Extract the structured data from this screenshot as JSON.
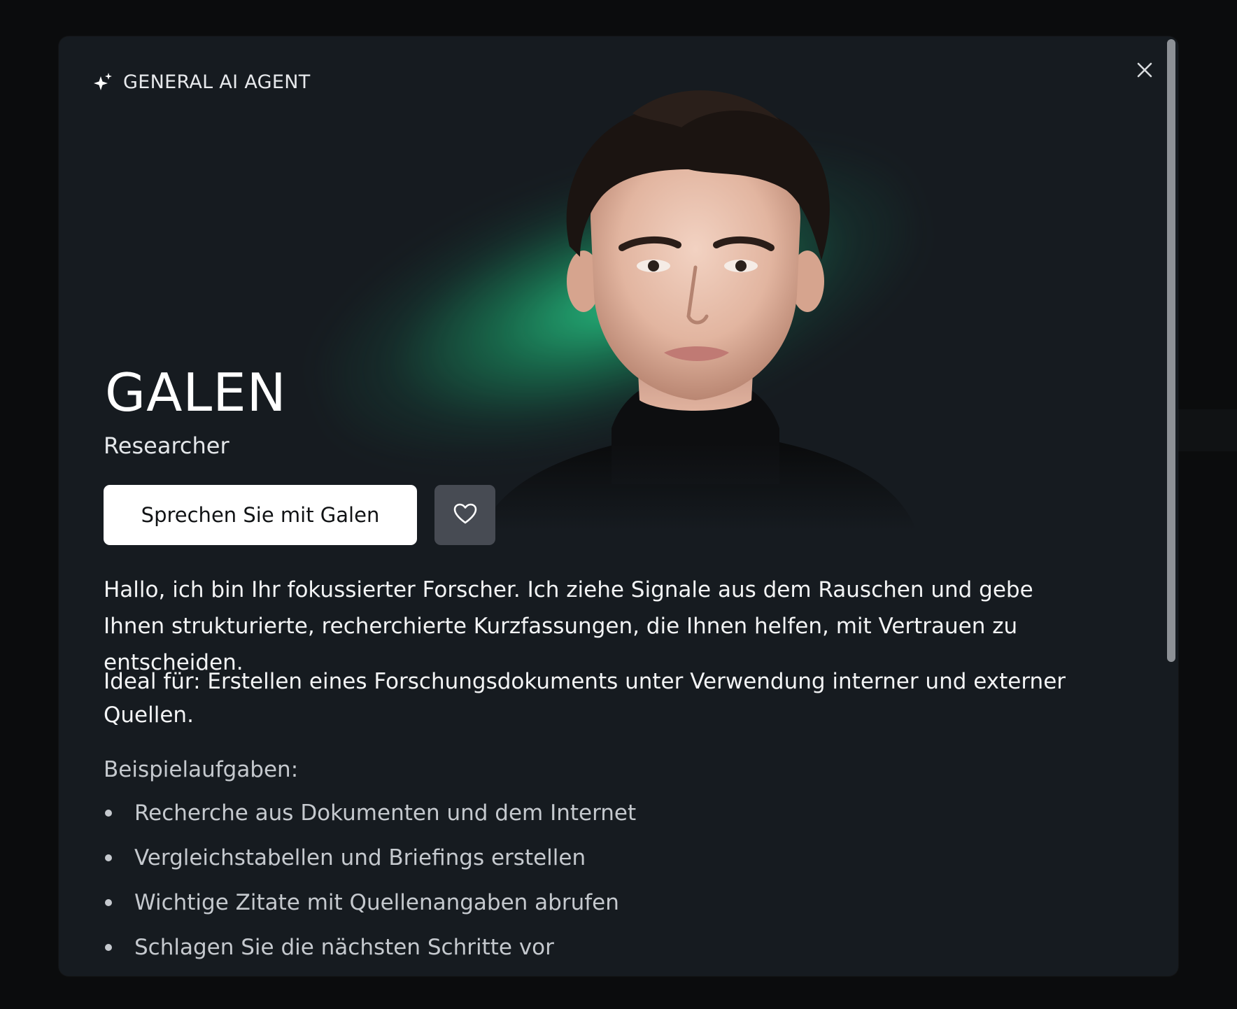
{
  "agent": {
    "category": "GENERAL AI AGENT",
    "name": "GALEN",
    "role": "Researcher"
  },
  "actions": {
    "talk_label": "Sprechen Sie mit Galen",
    "favorite_icon": "heart-icon",
    "close_icon": "close-icon"
  },
  "content": {
    "description": "Hallo, ich bin Ihr fokussierter Forscher. Ich ziehe Signale aus dem Rauschen und gebe Ihnen strukturierte, recherchierte Kurzfassungen, die Ihnen helfen, mit Vertrauen zu entscheiden.",
    "ideal_for": "Ideal für: Erstellen eines Forschungsdokuments unter Verwendung interner und externer Quellen.",
    "tasks_title": "Beispielaufgaben:",
    "tasks": [
      "Recherche aus Dokumenten und dem Internet",
      "Vergleichstabellen und Briefings erstellen",
      "Wichtige Zitate mit Quellenangaben abrufen",
      "Schlagen Sie die nächsten Schritte vor"
    ]
  },
  "colors": {
    "modal_bg": "#161b20",
    "glow": "#28d28c",
    "primary_button_bg": "#ffffff",
    "secondary_button_bg": "#474b53"
  }
}
